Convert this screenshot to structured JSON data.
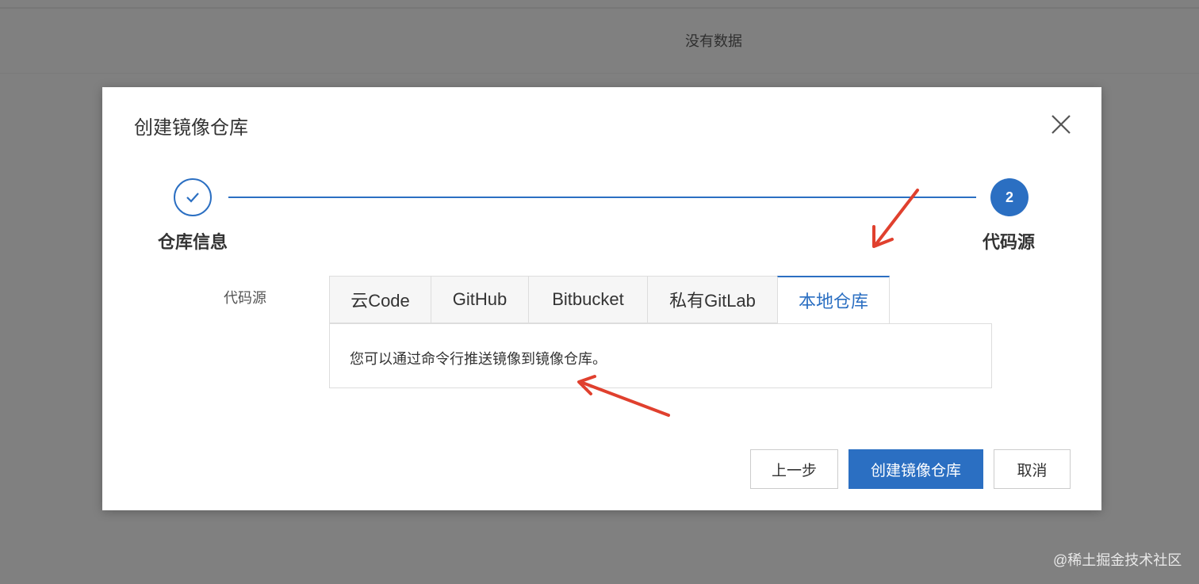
{
  "background": {
    "empty_text": "没有数据"
  },
  "dialog": {
    "title": "创建镜像仓库",
    "steps": [
      {
        "label": "仓库信息",
        "status": "done"
      },
      {
        "label": "代码源",
        "number": "2",
        "status": "current"
      }
    ],
    "field_label": "代码源",
    "tabs": [
      {
        "label": "云Code",
        "active": false
      },
      {
        "label": "GitHub",
        "active": false
      },
      {
        "label": "Bitbucket",
        "active": false
      },
      {
        "label": "私有GitLab",
        "active": false
      },
      {
        "label": "本地仓库",
        "active": true
      }
    ],
    "tab_panel_text": "您可以通过命令行推送镜像到镜像仓库。",
    "buttons": {
      "prev": "上一步",
      "create": "创建镜像仓库",
      "cancel": "取消"
    }
  },
  "colors": {
    "accent": "#2b6fc2",
    "annotation_arrow": "#e0402e",
    "overlay": "#808080"
  },
  "watermark": "@稀土掘金技术社区"
}
